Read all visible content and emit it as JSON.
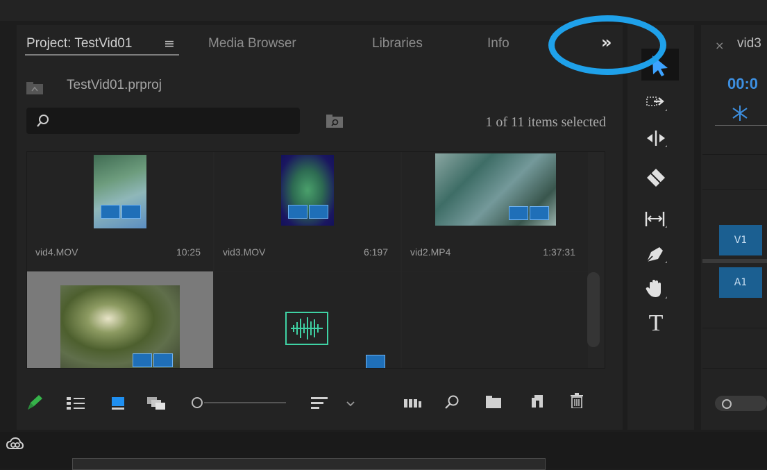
{
  "project_panel": {
    "tabs": [
      {
        "label": "Project: TestVid01",
        "active": true
      },
      {
        "label": "Media Browser"
      },
      {
        "label": "Libraries"
      },
      {
        "label": "Info"
      }
    ],
    "overflow_label": "»",
    "hamburger": "≡",
    "project_file": "TestVid01.prproj",
    "search": {
      "value": "",
      "placeholder": ""
    },
    "items_count": "1 of 11 items selected",
    "items": [
      {
        "name": "vid4.MOV",
        "duration": "10:25"
      },
      {
        "name": "vid3.MOV",
        "duration": "6:197"
      },
      {
        "name": "vid2.MP4",
        "duration": "1:37:31"
      },
      {
        "name": "",
        "duration": "",
        "selected": true
      },
      {
        "name": "",
        "duration": ""
      }
    ]
  },
  "tools": [
    "selection-tool",
    "track-select-tool",
    "ripple-edit-tool",
    "razor-tool",
    "slip-tool",
    "pen-tool",
    "hand-tool",
    "type-tool"
  ],
  "tool_glyphs": {
    "type": "T"
  },
  "timeline": {
    "tab_close": "×",
    "tab_label": "vid3",
    "timecode": "00:0",
    "tracks": [
      "V1",
      "A1"
    ]
  },
  "colors": {
    "accent": "#1fa1ea",
    "audio_green": "#3fd2a4",
    "track_blue": "#1b5f91"
  }
}
